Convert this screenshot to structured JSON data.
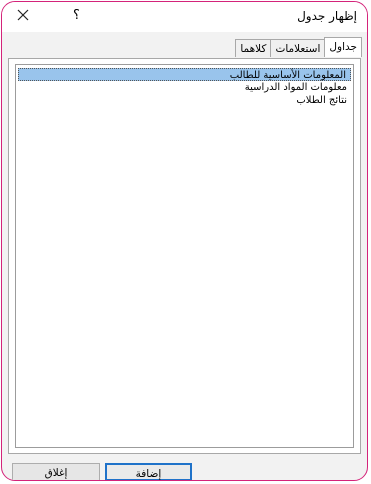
{
  "window": {
    "title": "إظهار جدول",
    "help_label": "؟",
    "close_icon": "close-icon"
  },
  "tabs": [
    {
      "label": "جداول",
      "active": true
    },
    {
      "label": "استعلامات",
      "active": false
    },
    {
      "label": "كلاهما",
      "active": false
    }
  ],
  "list": {
    "items": [
      {
        "label": "المعلومات الأساسية للطالب",
        "selected": true
      },
      {
        "label": "معلومات المواد الدراسية",
        "selected": false
      },
      {
        "label": "نتائج الطلاب",
        "selected": false
      }
    ]
  },
  "buttons": {
    "add_label": "إضافة",
    "close_label": "إغلاق"
  },
  "colors": {
    "frame_border": "#d4237a",
    "selection": "#99c4ec",
    "default_button_border": "#1f72c9"
  }
}
